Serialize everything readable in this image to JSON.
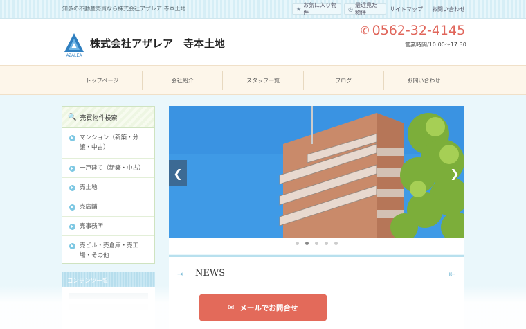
{
  "topbar": {
    "tagline": "知多の不動産売買なら株式会社アザレア 寺本土地",
    "favorites": "お気に入り物件",
    "recent": "最近見た物件",
    "sitemap": "サイトマップ",
    "contact": "お問い合わせ"
  },
  "header": {
    "logo_text": "AZALEA",
    "company": "株式会社アザレア　寺本土地",
    "phone": "0562-32-4145",
    "hours": "営業時間/10:00～17:30"
  },
  "nav": {
    "items": [
      "トップページ",
      "会社紹介",
      "スタッフ一覧",
      "ブログ",
      "お問い合わせ"
    ]
  },
  "sidebar": {
    "title": "売買物件検索",
    "items": [
      "マンション（新築・分譲・中古）",
      "一戸建て（新築・中古）",
      "売土地",
      "売店舗",
      "売事務所",
      "売ビル・売倉庫・売工場・その他"
    ],
    "contents_title": "コンテンツ一覧"
  },
  "slider": {
    "current_slide": 2,
    "total_slides": 5
  },
  "news": {
    "title": "NEWS"
  },
  "cta": {
    "label": "メールでお問合せ"
  },
  "colors": {
    "accent_red": "#e36a5a",
    "sky_blue": "#7ec8e3",
    "nav_bg": "#fdf6ea"
  }
}
